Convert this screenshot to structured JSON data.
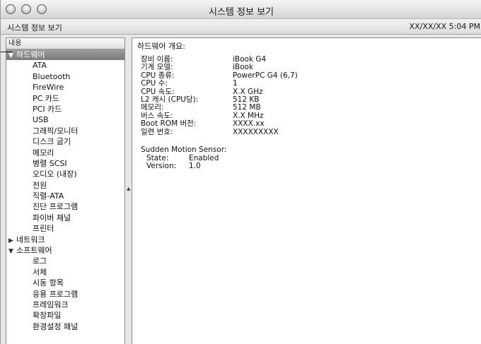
{
  "window": {
    "title": "시스템 정보 보기",
    "computer_name": "시스템 정보 보기",
    "clock": "XX/XX/XX 5:04 PM"
  },
  "sidebar": {
    "header": "내용",
    "categories": [
      {
        "label": "하드웨어",
        "expanded": true,
        "selected": true,
        "items": [
          "ATA",
          "Bluetooth",
          "FireWire",
          "PC 카드",
          "PCI 카드",
          "USB",
          "그래픽/모니터",
          "디스크 굽기",
          "메모리",
          "병렬 SCSI",
          "오디오 (내장)",
          "전원",
          "직렬-ATA",
          "진단 프로그램",
          "파이버 채널",
          "프린터"
        ]
      },
      {
        "label": "네트워크",
        "expanded": false,
        "selected": false,
        "items": []
      },
      {
        "label": "소프트웨어",
        "expanded": true,
        "selected": false,
        "items": [
          "로그",
          "서체",
          "시동 항목",
          "응용 프로그램",
          "프레임워크",
          "확장파일",
          "환경설정 패널"
        ]
      }
    ]
  },
  "detail": {
    "heading": "하드웨어 개요:",
    "properties": [
      {
        "label": "장비 이름:",
        "value": "iBook G4"
      },
      {
        "label": "기계 모델:",
        "value": "iBook"
      },
      {
        "label": "CPU 종류:",
        "value": "PowerPC G4 (6,7)"
      },
      {
        "label": "CPU 수:",
        "value": "1"
      },
      {
        "label": "CPU 속도:",
        "value": "X.X GHz"
      },
      {
        "label": "L2 캐시 (CPU당):",
        "value": "512 KB"
      },
      {
        "label": "메모리:",
        "value": "512 MB"
      },
      {
        "label": "버스 속도:",
        "value": "X.X MHz"
      },
      {
        "label": "Boot ROM 버전:",
        "value": "XXXX.xx"
      },
      {
        "label": "일련 번호:",
        "value": "XXXXXXXXX"
      }
    ],
    "sms": {
      "title": "Sudden Motion Sensor:",
      "state_label": "State:",
      "state_value": "Enabled",
      "version_label": "Version:",
      "version_value": "1.0"
    }
  },
  "icons": {
    "expanded": "▼",
    "collapsed": "▶",
    "splitter": "▲"
  }
}
